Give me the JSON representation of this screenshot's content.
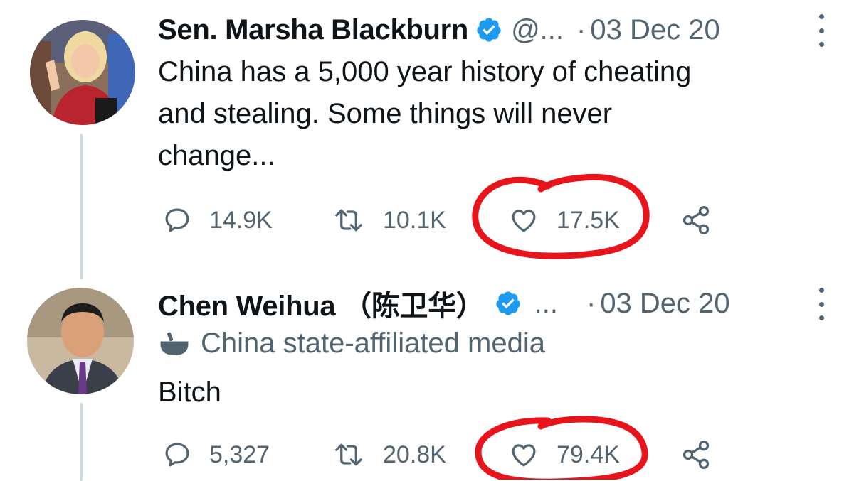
{
  "tweets": [
    {
      "author_name": "Sen. Marsha Blackburn",
      "handle": "@...",
      "date": "03 Dec 20",
      "verified": true,
      "body": "China has a 5,000 year history of cheating\nand stealing. Some things will never\nchange...",
      "replies": "14.9K",
      "retweets": "10.1K",
      "likes": "17.5K"
    },
    {
      "author_name": "Chen Weihua （陈卫华）",
      "handle": "...",
      "date": "03 Dec 20",
      "verified": true,
      "affiliation_label": "China state-affiliated media",
      "body": "Bitch",
      "replies": "5,327",
      "retweets": "20.8K",
      "likes": "79.4K"
    }
  ],
  "icons": {
    "reply": "speech-bubble-icon",
    "retweet": "retweet-arrows-icon",
    "like": "heart-icon",
    "share": "share-icon",
    "verified": "verified-badge-icon",
    "affiliation": "podium-icon",
    "more": "vertical-ellipsis-icon"
  },
  "colors": {
    "text_primary": "#0f1419",
    "text_secondary": "#536471",
    "verified_blue": "#1d9bf0",
    "annotation_red": "#e8141b",
    "thread_line": "#cfd9de"
  }
}
